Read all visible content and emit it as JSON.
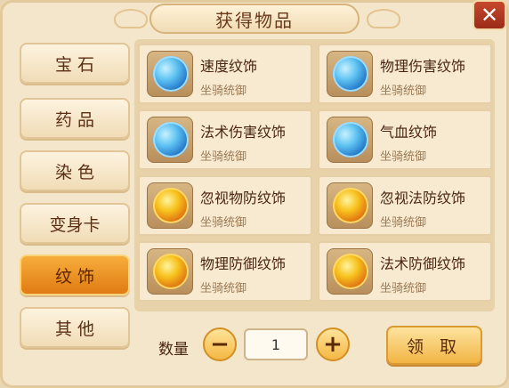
{
  "dialog": {
    "title": "获得物品",
    "close_label": "✕"
  },
  "sidebar": {
    "items": [
      {
        "label": "宝 石",
        "active": false
      },
      {
        "label": "药 品",
        "active": false
      },
      {
        "label": "染 色",
        "active": false
      },
      {
        "label": "变身卡",
        "active": false
      },
      {
        "label": "纹 饰",
        "active": true
      },
      {
        "label": "其 他",
        "active": false
      }
    ]
  },
  "items": [
    {
      "name": "速度纹饰",
      "sub": "坐骑统御",
      "gem": "blue"
    },
    {
      "name": "物理伤害纹饰",
      "sub": "坐骑统御",
      "gem": "blue"
    },
    {
      "name": "法术伤害纹饰",
      "sub": "坐骑统御",
      "gem": "blue"
    },
    {
      "name": "气血纹饰",
      "sub": "坐骑统御",
      "gem": "blue"
    },
    {
      "name": "忽视物防纹饰",
      "sub": "坐骑统御",
      "gem": "gold"
    },
    {
      "name": "忽视法防纹饰",
      "sub": "坐骑统御",
      "gem": "gold"
    },
    {
      "name": "物理防御纹饰",
      "sub": "坐骑统御",
      "gem": "gold"
    },
    {
      "name": "法术防御纹饰",
      "sub": "坐骑统御",
      "gem": "gold"
    }
  ],
  "quantity": {
    "label": "数量",
    "minus": "−",
    "value": "1",
    "plus": "+"
  },
  "claim_label": "领 取",
  "colors": {
    "active_tab": "#e99226",
    "blue_gem": "#2b86d6",
    "gold_gem": "#f0a21e"
  }
}
